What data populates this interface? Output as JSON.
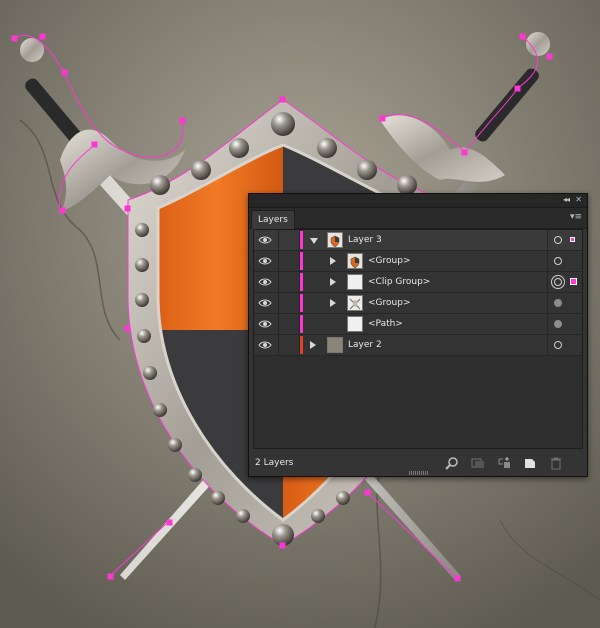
{
  "artwork": {
    "colors": {
      "selection": "#ff36d4",
      "orange": "#e0661c",
      "dark_wood": "#3b3b3d",
      "metal": "#b8b3aa",
      "stone": "#8b8577"
    }
  },
  "panel": {
    "tab_label": "Layers",
    "collapse_icon": "double-chevron-icon",
    "close_icon": "close-icon",
    "menu_icon": "panel-menu-icon",
    "layers": [
      {
        "name": "Layer 3",
        "visible": true,
        "expanded": true,
        "color": "#ff36d4",
        "thumb": "shield-thumb",
        "target": "hollow",
        "selected": true
      },
      {
        "name": "<Group>",
        "visible": true,
        "expanded": false,
        "color": "#ff36d4",
        "thumb": "shield-thumb",
        "target": "hollow",
        "selected": false
      },
      {
        "name": "<Clip Group>",
        "visible": true,
        "expanded": false,
        "color": "#ff36d4",
        "thumb": "blank-thumb",
        "target": "double",
        "selected": true
      },
      {
        "name": "<Group>",
        "visible": true,
        "expanded": false,
        "color": "#ff36d4",
        "thumb": "swords-thumb",
        "target": "filled",
        "selected": false
      },
      {
        "name": "<Path>",
        "visible": true,
        "expanded": null,
        "color": "#ff36d4",
        "thumb": "blank-thumb",
        "target": "filled",
        "selected": false
      },
      {
        "name": "Layer 2",
        "visible": true,
        "expanded": false,
        "color": "#e0402a",
        "thumb": "stone-thumb",
        "target": "hollow",
        "selected": false
      }
    ],
    "footer": {
      "count_label": "2 Layers",
      "icons": [
        "search-icon",
        "make-clipping-mask-icon",
        "new-sublayer-icon",
        "new-layer-icon",
        "delete-icon"
      ]
    }
  }
}
